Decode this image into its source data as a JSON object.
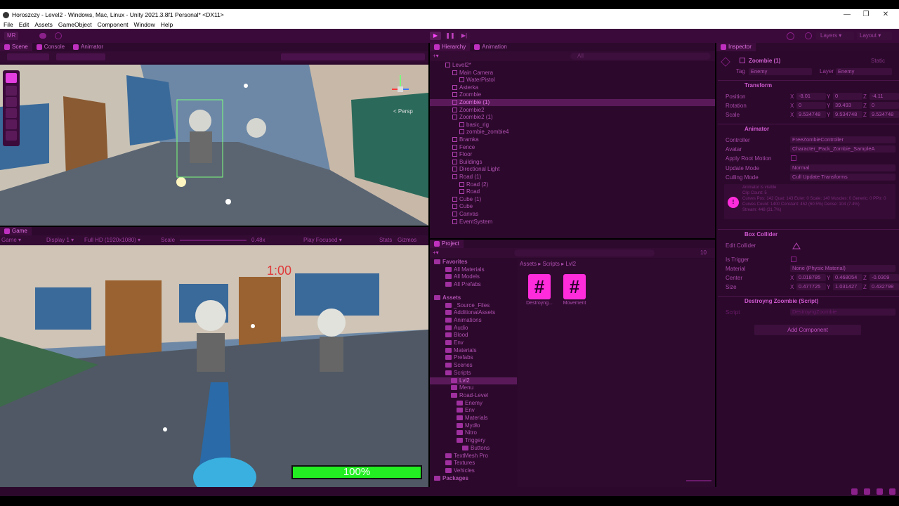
{
  "window": {
    "title": "Horoszczy - Level2 - Windows, Mac, Linux - Unity 2021.3.8f1 Personal* <DX11>",
    "controls": [
      "—",
      "❐",
      "✕"
    ]
  },
  "menu": [
    "File",
    "Edit",
    "Assets",
    "GameObject",
    "Component",
    "Window",
    "Help"
  ],
  "toolbar": {
    "account": "MR",
    "layers": "Layers",
    "layout": "Layout"
  },
  "scene_tabs": [
    "Scene",
    "Console",
    "Animator"
  ],
  "scene_view": {
    "persp_label": "< Persp"
  },
  "game_tabs": [
    "Game"
  ],
  "game_bar": {
    "mode": "Game",
    "display": "Display 1",
    "resolution": "Full HD (1920x1080)",
    "scale_label": "Scale",
    "scale_value": "0.48x",
    "play_focused": "Play Focused",
    "stats": "Stats",
    "gizmos": "Gizmos"
  },
  "game_view": {
    "timer": "1:00",
    "health_text": "100%",
    "health_fraction": 1.0
  },
  "hierarchy": {
    "tabs": [
      "Hierarchy",
      "Animation"
    ],
    "search_placeholder": "All",
    "items": [
      {
        "label": "Level2*",
        "selected": false
      },
      {
        "label": "Main Camera",
        "selected": false
      },
      {
        "label": "WaterPistol",
        "selected": false
      },
      {
        "label": "Asterka",
        "selected": false
      },
      {
        "label": "Zoombie",
        "selected": false
      },
      {
        "label": "Zoombie (1)",
        "selected": true
      },
      {
        "label": "Zoombie2",
        "selected": false
      },
      {
        "label": "Zoombie2 (1)",
        "selected": false
      },
      {
        "label": "basic_rig",
        "selected": false
      },
      {
        "label": "zombie_zombie4",
        "selected": false
      },
      {
        "label": "Bramka",
        "selected": false
      },
      {
        "label": "Fence",
        "selected": false
      },
      {
        "label": "Floor",
        "selected": false
      },
      {
        "label": "Buildings",
        "selected": false
      },
      {
        "label": "Directional Light",
        "selected": false
      },
      {
        "label": "Road (1)",
        "selected": false
      },
      {
        "label": "Road (2)",
        "selected": false
      },
      {
        "label": "Road",
        "selected": false
      },
      {
        "label": "Cube (1)",
        "selected": false
      },
      {
        "label": "Cube",
        "selected": false
      },
      {
        "label": "Canvas",
        "selected": false
      },
      {
        "label": "EventSystem",
        "selected": false
      }
    ]
  },
  "project": {
    "tab": "Project",
    "count": "10",
    "breadcrumb": [
      "Assets",
      "Scripts",
      "Lvl2"
    ],
    "favorites_title": "Favorites",
    "favorites": [
      "All Materials",
      "All Models",
      "All Prefabs"
    ],
    "assets_title": "Assets",
    "folders": [
      "_Source_Files",
      "AdditionalAssets",
      "Animations",
      "Audio",
      "Blood",
      "Env",
      "Materials",
      "Prefabs",
      "Scenes",
      "Scripts",
      "Lvl2",
      "Menu",
      "Road-Level",
      "Enemy",
      "Env",
      "Materials",
      "Mydło",
      "Nitro",
      "Triggery",
      "Buttons",
      "TextMesh Pro",
      "Textures",
      "Vehicles"
    ],
    "packages_title": "Packages",
    "files": [
      {
        "name": "Destroyng...",
        "glyph": "#"
      },
      {
        "name": "Movement",
        "glyph": "#"
      }
    ]
  },
  "inspector": {
    "tab": "Inspector",
    "object_name": "Zoombie (1)",
    "static_label": "Static",
    "tag_label": "Tag",
    "tag_value": "Enemy",
    "layer_label": "Layer",
    "layer_value": "Enemy",
    "transform": {
      "title": "Transform",
      "position_label": "Position",
      "position": [
        "-8.01",
        "0",
        "-4.11"
      ],
      "rotation_label": "Rotation",
      "rotation": [
        "0",
        "39.493",
        "0"
      ],
      "scale_label": "Scale",
      "scale": [
        "9.534748",
        "9.534748",
        "9.534748"
      ]
    },
    "animator": {
      "title": "Animator",
      "controller_label": "Controller",
      "controller_value": "FreeZombieController",
      "avatar_label": "Avatar",
      "avatar_value": "Character_Pack_Zombie_SampleA",
      "root_motion_label": "Apply Root Motion",
      "update_label": "Update Mode",
      "update_value": "Normal",
      "culling_label": "Culling Mode",
      "culling_value": "Cull Update Transforms",
      "info": [
        "Animator is visible",
        "Clip Count: 5",
        "Curves Pos: 142 Quat: 143 Euler: 0 Scale: 140 Muscles: 0 Generic: 0 PPtr: 0",
        "Curves Count: 1400 Constant: 452 (60.5%) Dense: 104 (7.4%)",
        "Stream: 448 (31.7%)"
      ]
    },
    "box_collider": {
      "title": "Box Collider",
      "edit_label": "Edit Collider",
      "trigger_label": "Is Trigger",
      "material_label": "Material",
      "material_value": "None (Physic Material)",
      "center_label": "Center",
      "center": [
        "0.018785",
        "0.468054",
        "-0.0309"
      ],
      "size_label": "Size",
      "size": [
        "0.477725",
        "1.031427",
        "0.432798"
      ]
    },
    "script": {
      "title": "Destroyng Zoombie (Script)",
      "label": "Script",
      "value": "DestroyngZoombie"
    },
    "add_component": "Add Component"
  },
  "colors": {
    "accent": "#e23ee0",
    "panel": "#2c092c",
    "health": "#22ee22"
  }
}
